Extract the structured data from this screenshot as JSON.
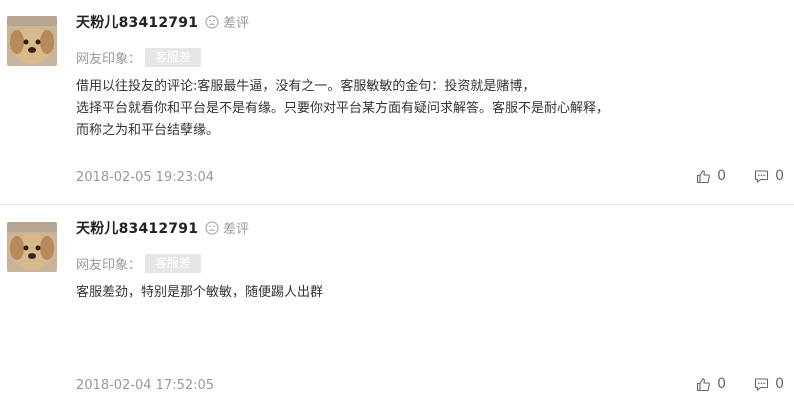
{
  "reviews": [
    {
      "username": "天粉儿83412791",
      "rating_label": "差评",
      "impression_label": "网友印象：",
      "tag": "客服差",
      "content_lines": [
        "借用以往投友的评论:客服最牛逼，没有之一。客服敏敏的金句：投资就是赌博，",
        "选择平台就看你和平台是不是有缘。只要你对平台某方面有疑问求解答。客服不是耐心解释，",
        "而称之为和平台结孽缘。"
      ],
      "date": "2018-02-05 19:23:04",
      "likes": "0",
      "comments": "0"
    },
    {
      "username": "天粉儿83412791",
      "rating_label": "差评",
      "impression_label": "网友印象：",
      "tag": "客服差",
      "content_lines": [
        "客服差劲，特别是那个敏敏，随便踢人出群"
      ],
      "date": "2018-02-04 17:52:05",
      "likes": "0",
      "comments": "0"
    }
  ]
}
